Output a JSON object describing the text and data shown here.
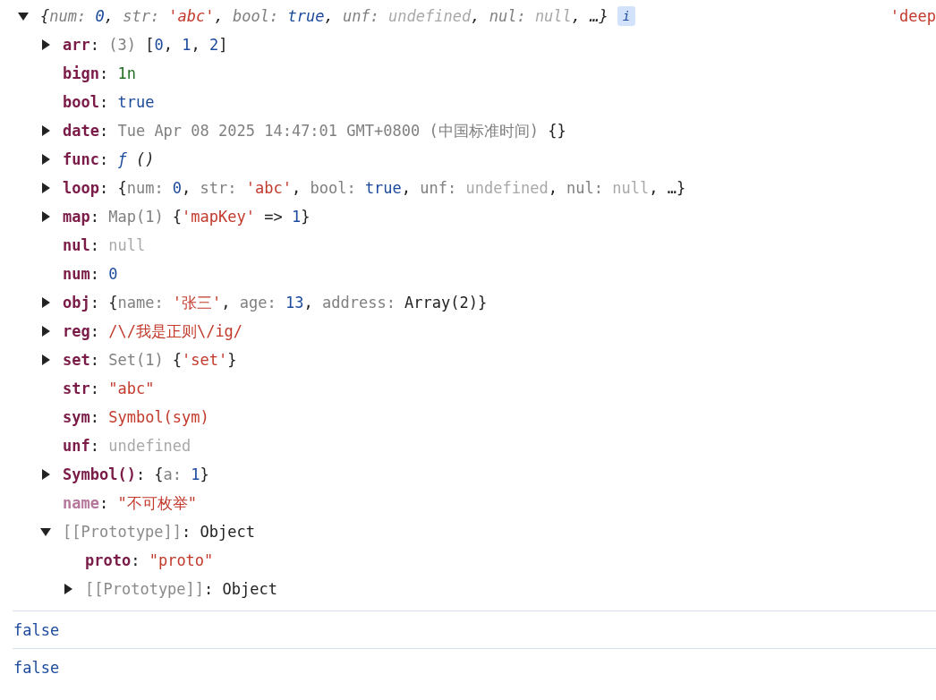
{
  "tree": {
    "expanded": true,
    "italic": true,
    "value": [
      {
        "kind": "punct",
        "text": "{"
      },
      {
        "kind": "dim",
        "text": "num: "
      },
      {
        "kind": "number",
        "text": "0"
      },
      {
        "kind": "punct",
        "text": ", "
      },
      {
        "kind": "dim",
        "text": "str: "
      },
      {
        "kind": "string",
        "text": "'abc'"
      },
      {
        "kind": "punct",
        "text": ", "
      },
      {
        "kind": "dim",
        "text": "bool: "
      },
      {
        "kind": "number",
        "text": "true"
      },
      {
        "kind": "punct",
        "text": ", "
      },
      {
        "kind": "dim",
        "text": "unf: "
      },
      {
        "kind": "empty",
        "text": "undefined"
      },
      {
        "kind": "punct",
        "text": ", "
      },
      {
        "kind": "dim",
        "text": "nul: "
      },
      {
        "kind": "empty",
        "text": "null"
      },
      {
        "kind": "punct",
        "text": ", …}"
      }
    ],
    "badge": "i",
    "aside": "'deep",
    "children": [
      {
        "key": "arr",
        "kind": "property",
        "expanded": false,
        "value": [
          {
            "kind": "punct",
            "text": ": "
          },
          {
            "kind": "dim",
            "text": "(3) "
          },
          {
            "kind": "punct",
            "text": "["
          },
          {
            "kind": "number",
            "text": "0"
          },
          {
            "kind": "punct",
            "text": ", "
          },
          {
            "kind": "number",
            "text": "1"
          },
          {
            "kind": "punct",
            "text": ", "
          },
          {
            "kind": "number",
            "text": "2"
          },
          {
            "kind": "punct",
            "text": "]"
          }
        ]
      },
      {
        "key": "bign",
        "kind": "property",
        "value": [
          {
            "kind": "punct",
            "text": ": "
          },
          {
            "kind": "bigint",
            "text": "1n"
          }
        ]
      },
      {
        "key": "bool",
        "kind": "property",
        "value": [
          {
            "kind": "punct",
            "text": ": "
          },
          {
            "kind": "number",
            "text": "true"
          }
        ]
      },
      {
        "key": "date",
        "kind": "property",
        "expanded": false,
        "value": [
          {
            "kind": "punct",
            "text": ": "
          },
          {
            "kind": "dim",
            "text": "Tue Apr 08 2025 14:47:01 GMT+0800 (中国标准时间) "
          },
          {
            "kind": "punct",
            "text": "{}"
          }
        ]
      },
      {
        "key": "func",
        "kind": "property",
        "expanded": false,
        "value": [
          {
            "kind": "punct",
            "text": ": "
          },
          {
            "kind": "function",
            "text": "ƒ"
          },
          {
            "kind": "args",
            "text": " ()"
          }
        ]
      },
      {
        "key": "loop",
        "kind": "property",
        "expanded": false,
        "value": [
          {
            "kind": "punct",
            "text": ": {"
          },
          {
            "kind": "dim",
            "text": "num: "
          },
          {
            "kind": "number",
            "text": "0"
          },
          {
            "kind": "punct",
            "text": ", "
          },
          {
            "kind": "dim",
            "text": "str: "
          },
          {
            "kind": "string",
            "text": "'abc'"
          },
          {
            "kind": "punct",
            "text": ", "
          },
          {
            "kind": "dim",
            "text": "bool: "
          },
          {
            "kind": "number",
            "text": "true"
          },
          {
            "kind": "punct",
            "text": ", "
          },
          {
            "kind": "dim",
            "text": "unf: "
          },
          {
            "kind": "empty",
            "text": "undefined"
          },
          {
            "kind": "punct",
            "text": ", "
          },
          {
            "kind": "dim",
            "text": "nul: "
          },
          {
            "kind": "empty",
            "text": "null"
          },
          {
            "kind": "punct",
            "text": ", …}"
          }
        ]
      },
      {
        "key": "map",
        "kind": "property",
        "expanded": false,
        "value": [
          {
            "kind": "punct",
            "text": ": "
          },
          {
            "kind": "dim",
            "text": "Map(1) "
          },
          {
            "kind": "punct",
            "text": "{"
          },
          {
            "kind": "string",
            "text": "'mapKey'"
          },
          {
            "kind": "punct",
            "text": " => "
          },
          {
            "kind": "number",
            "text": "1"
          },
          {
            "kind": "punct",
            "text": "}"
          }
        ]
      },
      {
        "key": "nul",
        "kind": "property",
        "value": [
          {
            "kind": "punct",
            "text": ": "
          },
          {
            "kind": "empty",
            "text": "null"
          }
        ]
      },
      {
        "key": "num",
        "kind": "property",
        "value": [
          {
            "kind": "punct",
            "text": ": "
          },
          {
            "kind": "number",
            "text": "0"
          }
        ]
      },
      {
        "key": "obj",
        "kind": "property",
        "expanded": false,
        "value": [
          {
            "kind": "punct",
            "text": ": {"
          },
          {
            "kind": "dim",
            "text": "name: "
          },
          {
            "kind": "string",
            "text": "'张三'"
          },
          {
            "kind": "punct",
            "text": ", "
          },
          {
            "kind": "dim",
            "text": "age: "
          },
          {
            "kind": "number",
            "text": "13"
          },
          {
            "kind": "punct",
            "text": ", "
          },
          {
            "kind": "dim",
            "text": "address: "
          },
          {
            "kind": "punct",
            "text": "Array(2)}"
          }
        ]
      },
      {
        "key": "reg",
        "kind": "property",
        "expanded": false,
        "value": [
          {
            "kind": "punct",
            "text": ": "
          },
          {
            "kind": "string",
            "text": "/\\/我是正则\\/ig/"
          }
        ]
      },
      {
        "key": "set",
        "kind": "property",
        "expanded": false,
        "value": [
          {
            "kind": "punct",
            "text": ": "
          },
          {
            "kind": "dim",
            "text": "Set(1) "
          },
          {
            "kind": "punct",
            "text": "{"
          },
          {
            "kind": "string",
            "text": "'set'"
          },
          {
            "kind": "punct",
            "text": "}"
          }
        ]
      },
      {
        "key": "str",
        "kind": "property",
        "value": [
          {
            "kind": "punct",
            "text": ": "
          },
          {
            "kind": "string",
            "text": "\"abc\""
          }
        ]
      },
      {
        "key": "sym",
        "kind": "property",
        "value": [
          {
            "kind": "punct",
            "text": ": "
          },
          {
            "kind": "string",
            "text": "Symbol(sym)"
          }
        ]
      },
      {
        "key": "unf",
        "kind": "property",
        "value": [
          {
            "kind": "punct",
            "text": ": "
          },
          {
            "kind": "empty",
            "text": "undefined"
          }
        ]
      },
      {
        "key": "Symbol()",
        "kind": "property",
        "expanded": false,
        "value": [
          {
            "kind": "punct",
            "text": ": {"
          },
          {
            "kind": "dim",
            "text": "a: "
          },
          {
            "kind": "number",
            "text": "1"
          },
          {
            "kind": "punct",
            "text": "}"
          }
        ]
      },
      {
        "key": "name",
        "kind": "nonenumerable",
        "value": [
          {
            "kind": "punct",
            "text": ": "
          },
          {
            "kind": "string",
            "text": "\"不可枚举\""
          }
        ]
      },
      {
        "key": "[[Prototype]]",
        "kind": "internal",
        "expanded": true,
        "value": [
          {
            "kind": "punct",
            "text": ": Object"
          }
        ],
        "children": [
          {
            "key": "proto",
            "kind": "property",
            "value": [
              {
                "kind": "punct",
                "text": ": "
              },
              {
                "kind": "string",
                "text": "\"proto\""
              }
            ]
          },
          {
            "key": "[[Prototype]]",
            "kind": "internal",
            "expanded": false,
            "value": [
              {
                "kind": "punct",
                "text": ": Object"
              }
            ]
          }
        ]
      }
    ]
  },
  "outputs": [
    {
      "kind": "bool",
      "text": "false"
    },
    {
      "kind": "bool",
      "text": "false"
    }
  ]
}
